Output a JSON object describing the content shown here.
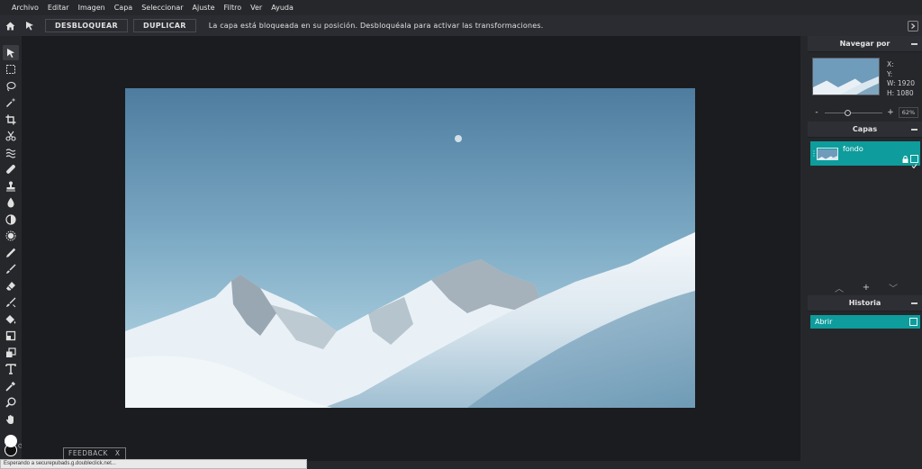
{
  "menu": [
    "Archivo",
    "Editar",
    "Imagen",
    "Capa",
    "Seleccionar",
    "Ajuste",
    "Filtro",
    "Ver",
    "Ayuda"
  ],
  "options": {
    "unlock_label": "DESBLOQUEAR",
    "duplicate_label": "DUPLICAR",
    "message": "La capa está bloqueada en su posición. Desbloquéala para activar las transformaciones."
  },
  "tools": [
    "move-tool-icon",
    "marquee-tool-icon",
    "lasso-tool-icon",
    "magic-wand-tool-icon",
    "crop-tool-icon",
    "cut-tool-icon",
    "liquify-tool-icon",
    "healing-tool-icon",
    "stamp-tool-icon",
    "blur-tool-icon",
    "sponge-tool-icon",
    "dodge-tool-icon",
    "pencil-tool-icon",
    "brush-tool-icon",
    "eraser-tool-icon",
    "color-replace-tool-icon",
    "paint-bucket-tool-icon",
    "rectangle-tool-icon",
    "shape-tool-icon",
    "text-tool-icon",
    "eyedropper-tool-icon",
    "zoom-tool-icon",
    "hand-tool-icon"
  ],
  "navigator": {
    "title": "Navegar por",
    "x_label": "X:",
    "y_label": "Y:",
    "w_label": "W:",
    "w_value": "1920",
    "h_label": "H:",
    "h_value": "1080",
    "zoom": "62%",
    "zoom_minus": "-",
    "zoom_plus": "+"
  },
  "layers": {
    "title": "Capas",
    "items": [
      {
        "name": "fondo"
      }
    ]
  },
  "history": {
    "title": "Historia",
    "items": [
      {
        "name": "Abrir"
      }
    ]
  },
  "feedback": {
    "label": "FEEDBACK",
    "close": "X"
  },
  "status": "Esperando a securepubads.g.doubleclick.net...",
  "colors": {
    "accent": "#0e9c9c",
    "foreground": "#ffffff",
    "background": "#111111"
  }
}
